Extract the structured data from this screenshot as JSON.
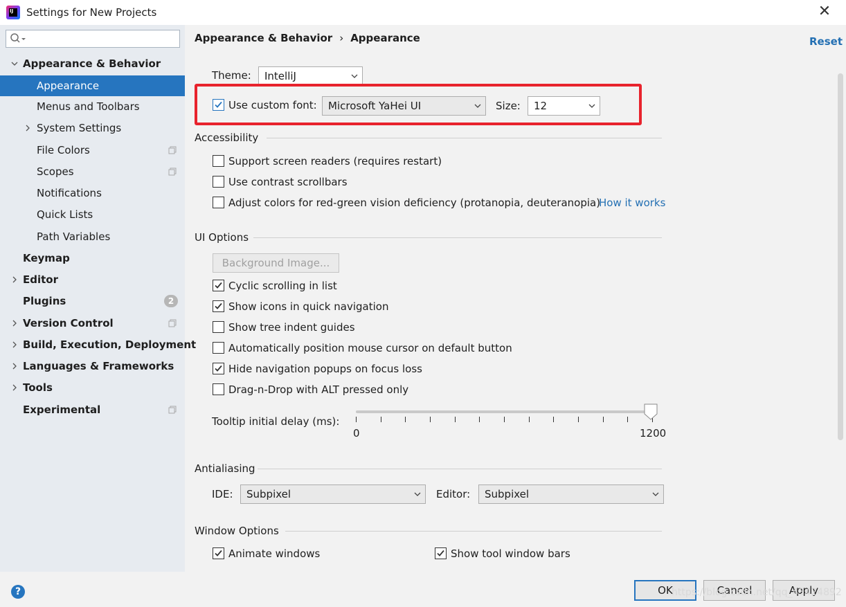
{
  "window": {
    "title": "Settings for New Projects",
    "logo_text": "IJ"
  },
  "sidebar": {
    "search_placeholder": "",
    "items": [
      {
        "label": "Appearance & Behavior",
        "bold": true,
        "expanded": true
      },
      {
        "label": "Appearance",
        "selected": true
      },
      {
        "label": "Menus and Toolbars"
      },
      {
        "label": "System Settings",
        "collapsed": true
      },
      {
        "label": "File Colors"
      },
      {
        "label": "Scopes"
      },
      {
        "label": "Notifications"
      },
      {
        "label": "Quick Lists"
      },
      {
        "label": "Path Variables"
      },
      {
        "label": "Keymap",
        "bold": true
      },
      {
        "label": "Editor",
        "bold": true,
        "collapsed": true
      },
      {
        "label": "Plugins",
        "bold": true,
        "badge": "2"
      },
      {
        "label": "Version Control",
        "bold": true,
        "collapsed": true
      },
      {
        "label": "Build, Execution, Deployment",
        "bold": true,
        "collapsed": true
      },
      {
        "label": "Languages & Frameworks",
        "bold": true,
        "collapsed": true
      },
      {
        "label": "Tools",
        "bold": true,
        "collapsed": true
      },
      {
        "label": "Experimental",
        "bold": true
      }
    ]
  },
  "breadcrumb": {
    "parent": "Appearance & Behavior",
    "separator": "›",
    "current": "Appearance"
  },
  "reset_label": "Reset",
  "theme": {
    "label": "Theme:",
    "value": "IntelliJ"
  },
  "custom_font": {
    "checkbox_label": "Use custom font:",
    "checked": true,
    "font_value": "Microsoft YaHei UI",
    "size_label": "Size:",
    "size_value": "12"
  },
  "accessibility": {
    "title": "Accessibility",
    "options": [
      {
        "label": "Support screen readers (requires restart)",
        "checked": false
      },
      {
        "label": "Use contrast scrollbars",
        "checked": false
      },
      {
        "label": "Adjust colors for red-green vision deficiency (protanopia, deuteranopia)",
        "checked": false
      }
    ],
    "how_it_works": "How it works"
  },
  "ui_options": {
    "title": "UI Options",
    "background_image_button": "Background Image...",
    "options": [
      {
        "label": "Cyclic scrolling in list",
        "checked": true
      },
      {
        "label": "Show icons in quick navigation",
        "checked": true
      },
      {
        "label": "Show tree indent guides",
        "checked": false
      },
      {
        "label": "Automatically position mouse cursor on default button",
        "checked": false
      },
      {
        "label": "Hide navigation popups on focus loss",
        "checked": true
      },
      {
        "label": "Drag-n-Drop with ALT pressed only",
        "checked": false
      }
    ],
    "tooltip_delay": {
      "label": "Tooltip initial delay (ms):",
      "min": "0",
      "max": "1200",
      "value": 1200
    }
  },
  "antialiasing": {
    "title": "Antialiasing",
    "ide_label": "IDE:",
    "ide_value": "Subpixel",
    "editor_label": "Editor:",
    "editor_value": "Subpixel"
  },
  "window_options": {
    "title": "Window Options",
    "options": [
      {
        "label": "Animate windows",
        "checked": true
      },
      {
        "label": "Show tool window bars",
        "checked": true
      }
    ]
  },
  "footer": {
    "help": "?",
    "ok": "OK",
    "cancel": "Cancel",
    "apply": "Apply",
    "watermark": "https://blog.csdn.net/qq_43424892"
  },
  "colors": {
    "selection": "#2675bf",
    "link": "#2470b3",
    "highlight_box": "#e8232d"
  }
}
